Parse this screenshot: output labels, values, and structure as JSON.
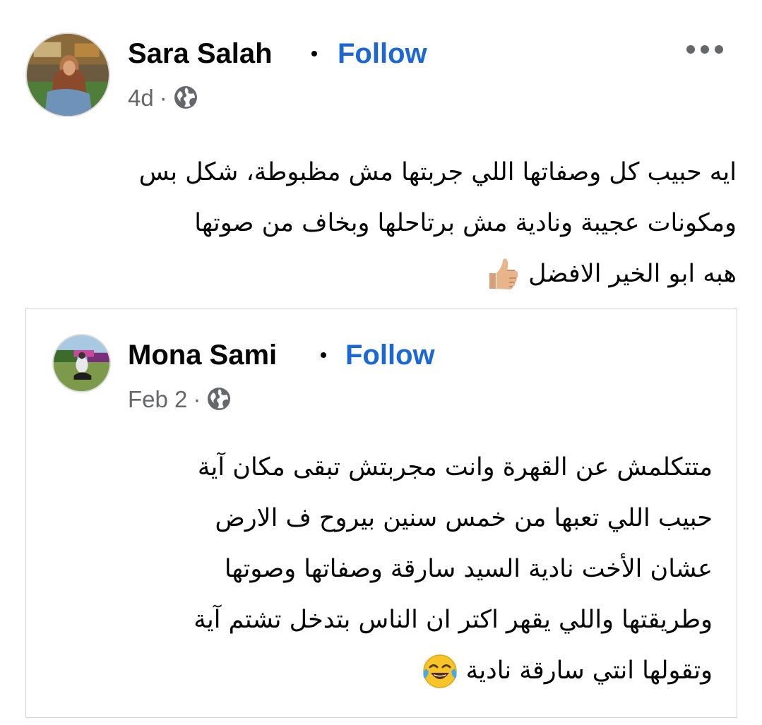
{
  "post": {
    "author": "Sara Salah",
    "follow_label": "Follow",
    "timestamp": "4d",
    "separator": "·",
    "audience_icon": "globe-icon",
    "more_icon": "more-options-icon",
    "text_lines": [
      "ايه حبيب كل وصفاتها اللي جربتها مش مظبوطة، شكل بس",
      "ومكونات عجيبة ونادية مش برتاحلها وبخاف من صوتها",
      "هبه ابو الخير الافضل"
    ],
    "line3_emoji": "thumbs-up-emoji"
  },
  "shared": {
    "author": "Mona Sami",
    "follow_label": "Follow",
    "timestamp": "Feb 2",
    "separator": "·",
    "audience_icon": "globe-icon",
    "text_lines": [
      "متتكلمش عن القهرة وانت مجربتش تبقى مكان آية",
      "حبيب اللي تعبها من خمس سنين بيروح ف الارض",
      "عشان الأخت نادية السيد سارقة وصفاتها وصوتها",
      "وطريقتها واللي يقهر اكتر ان الناس بتدخل تشتم آية",
      "وتقولها انتي سارقة نادية"
    ],
    "line5_emoji": "face-with-tears-of-joy-emoji"
  },
  "colors": {
    "follow": "#1b67d4",
    "meta": "#65676b",
    "text": "#050505",
    "card_border": "#d4d4d4"
  }
}
